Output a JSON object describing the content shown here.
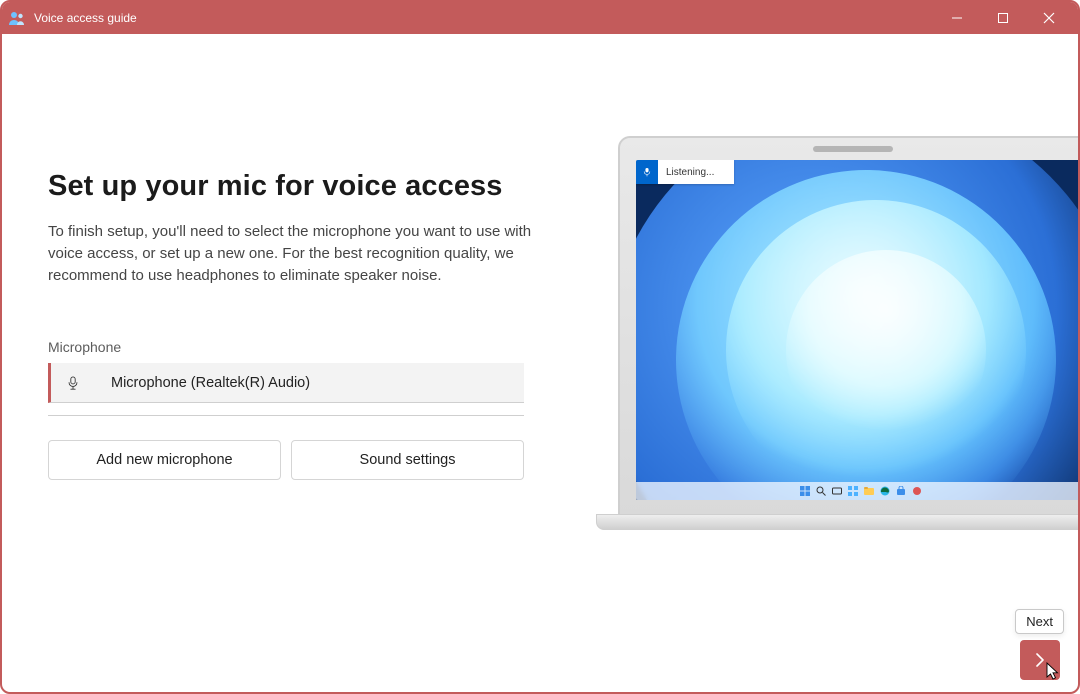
{
  "window": {
    "title": "Voice access guide"
  },
  "main": {
    "heading": "Set up your mic for voice access",
    "description": "To finish setup, you'll need to select the microphone you want to use with voice access, or set up a new one. For the best recognition quality, we recommend to use headphones to eliminate speaker noise.",
    "field_label": "Microphone",
    "selected_mic": "Microphone (Realtek(R) Audio)"
  },
  "buttons": {
    "add_mic": "Add new microphone",
    "sound_settings": "Sound settings"
  },
  "nav": {
    "next_tooltip": "Next"
  },
  "illustration": {
    "va_status": "Listening..."
  }
}
